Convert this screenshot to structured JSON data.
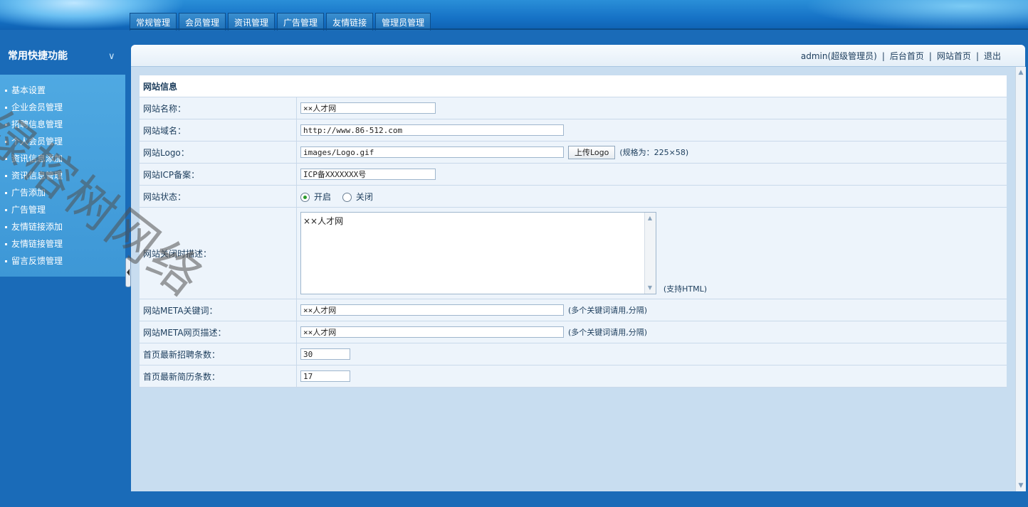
{
  "nav": {
    "tabs": [
      "常规管理",
      "会员管理",
      "资讯管理",
      "广告管理",
      "友情链接",
      "管理员管理"
    ]
  },
  "sidebar": {
    "title": "常用快捷功能",
    "items": [
      "基本设置",
      "企业会员管理",
      "招聘信息管理",
      "个人会员管理",
      "资讯信息添加",
      "资讯信息管理",
      "广告添加",
      "广告管理",
      "友情链接添加",
      "友情链接管理",
      "留言反馈管理"
    ]
  },
  "userbar": {
    "user": "admin(超级管理员)",
    "home_admin": "后台首页",
    "home_site": "网站首页",
    "logout": "退出",
    "sep": "|"
  },
  "form": {
    "caption": "网站信息",
    "site_name_label": "网站名称：",
    "site_name_value": "××人才网",
    "site_domain_label": "网站域名：",
    "site_domain_value": "http://www.86-512.com",
    "site_logo_label": "网站Logo：",
    "site_logo_value": "images/Logo.gif",
    "upload_button": "上传Logo",
    "logo_hint": "(规格为：225×58)",
    "icp_label": "网站ICP备案：",
    "icp_value": "ICP备XXXXXXX号",
    "status_label": "网站状态：",
    "status_on": "开启",
    "status_off": "关闭",
    "status_selected": "开启",
    "close_desc_label": "网站关闭时描述：",
    "close_desc_value": "××人才网",
    "close_desc_hint": "(支持HTML)",
    "meta_kw_label": "网站META关键词：",
    "meta_kw_value": "××人才网",
    "meta_kw_hint": "(多个关键词请用,分隔)",
    "meta_desc_label": "网站META网页描述：",
    "meta_desc_value": "××人才网",
    "meta_desc_hint": "(多个关键词请用,分隔)",
    "jobs_count_label": "首页最新招聘条数：",
    "jobs_count_value": "30",
    "resume_count_label": "首页最新简历条数：",
    "resume_count_value": "17"
  },
  "watermark": "绿榕树网络"
}
